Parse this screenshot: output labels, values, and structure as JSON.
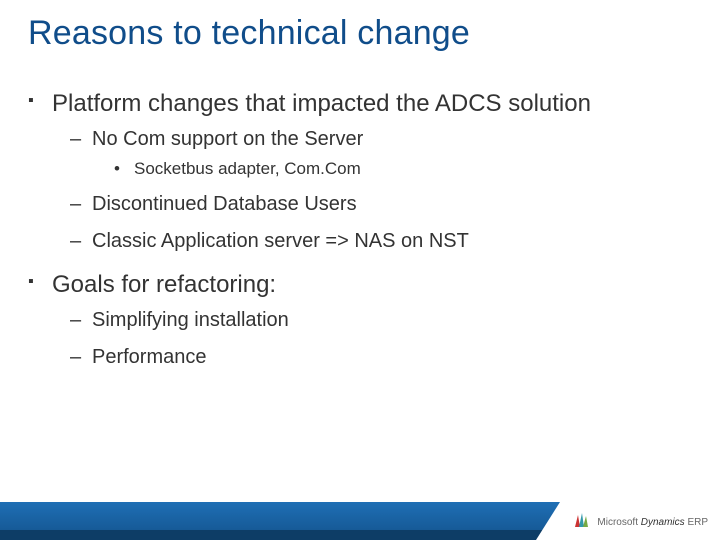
{
  "title": "Reasons to technical change",
  "bullets": [
    {
      "text": "Platform changes that impacted the ADCS solution",
      "children": [
        {
          "text": "No Com support on the Server",
          "children": [
            {
              "text": "Socketbus adapter, Com.Com"
            }
          ]
        },
        {
          "text": "Discontinued Database Users"
        },
        {
          "text": "Classic Application server => NAS on NST"
        }
      ]
    },
    {
      "text": "Goals for refactoring:",
      "children": [
        {
          "text": "Simplifying installation"
        },
        {
          "text": "Performance"
        }
      ]
    }
  ],
  "brand": {
    "microsoft": "Microsoft",
    "dynamics": "Dynamics",
    "erp": "ERP"
  }
}
